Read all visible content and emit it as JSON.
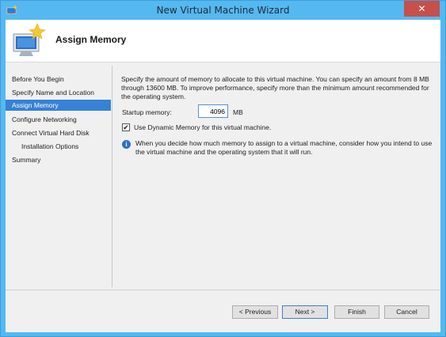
{
  "window": {
    "title": "New Virtual Machine Wizard",
    "close_label": "✕"
  },
  "header": {
    "title": "Assign Memory"
  },
  "nav": {
    "items": [
      {
        "label": "Before You Begin",
        "active": false,
        "sub": false
      },
      {
        "label": "Specify Name and Location",
        "active": false,
        "sub": false
      },
      {
        "label": "Assign Memory",
        "active": true,
        "sub": false
      },
      {
        "label": "Configure Networking",
        "active": false,
        "sub": false
      },
      {
        "label": "Connect Virtual Hard Disk",
        "active": false,
        "sub": false
      },
      {
        "label": "Installation Options",
        "active": false,
        "sub": true
      },
      {
        "label": "Summary",
        "active": false,
        "sub": false
      }
    ]
  },
  "content": {
    "description": "Specify the amount of memory to allocate to this virtual machine. You can specify an amount from 8 MB through 13600 MB. To improve performance, specify more than the minimum amount recommended for the operating system.",
    "startup_memory_label": "Startup memory:",
    "startup_memory_value": "4096",
    "startup_memory_unit": "MB",
    "dynamic_memory_checked": true,
    "dynamic_memory_label": "Use Dynamic Memory for this virtual machine.",
    "info_text": "When you decide how much memory to assign to a virtual machine, consider how you intend to use the virtual machine and the operating system that it will run."
  },
  "buttons": {
    "previous": "< Previous",
    "next": "Next >",
    "finish": "Finish",
    "cancel": "Cancel"
  },
  "colors": {
    "titlebar": "#56b8f0",
    "close": "#c7504a",
    "nav_active": "#3582d6"
  },
  "icons": {
    "app": "monitor-star-icon",
    "header": "monitor-star-icon",
    "info": "info-icon",
    "check": "checkmark-icon"
  }
}
